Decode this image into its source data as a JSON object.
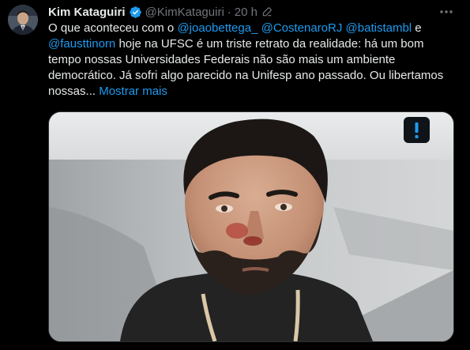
{
  "tweet": {
    "author_name": "Kim Kataguiri",
    "handle": "@KimKataguiri",
    "separator": "·",
    "time": "20 h",
    "text_part1": "O que aconteceu com o ",
    "mention1": "@joaobettega_",
    "text_part2": " ",
    "mention2": "@CostenaroRJ",
    "text_part3": " ",
    "mention3": "@batistambl",
    "text_part4": " e ",
    "mention4": "@fausttinorn",
    "text_part5": " hoje na UFSC é um triste retrato da realidade: há um bom tempo nossas Universidades Federais não são mais um ambiente democrático. Já sofri algo parecido na Unifesp ano passado. Ou libertamos nossas... ",
    "show_more": "Mostrar mais"
  },
  "icons": {
    "verified": "verified-badge-icon",
    "edited": "edit-pencil-icon",
    "more": "more-options-icon",
    "media_badge": "exclamation-icon"
  },
  "colors": {
    "background": "#000000",
    "text": "#e7e9ea",
    "secondary": "#71767b",
    "link": "#1d9bf0"
  }
}
